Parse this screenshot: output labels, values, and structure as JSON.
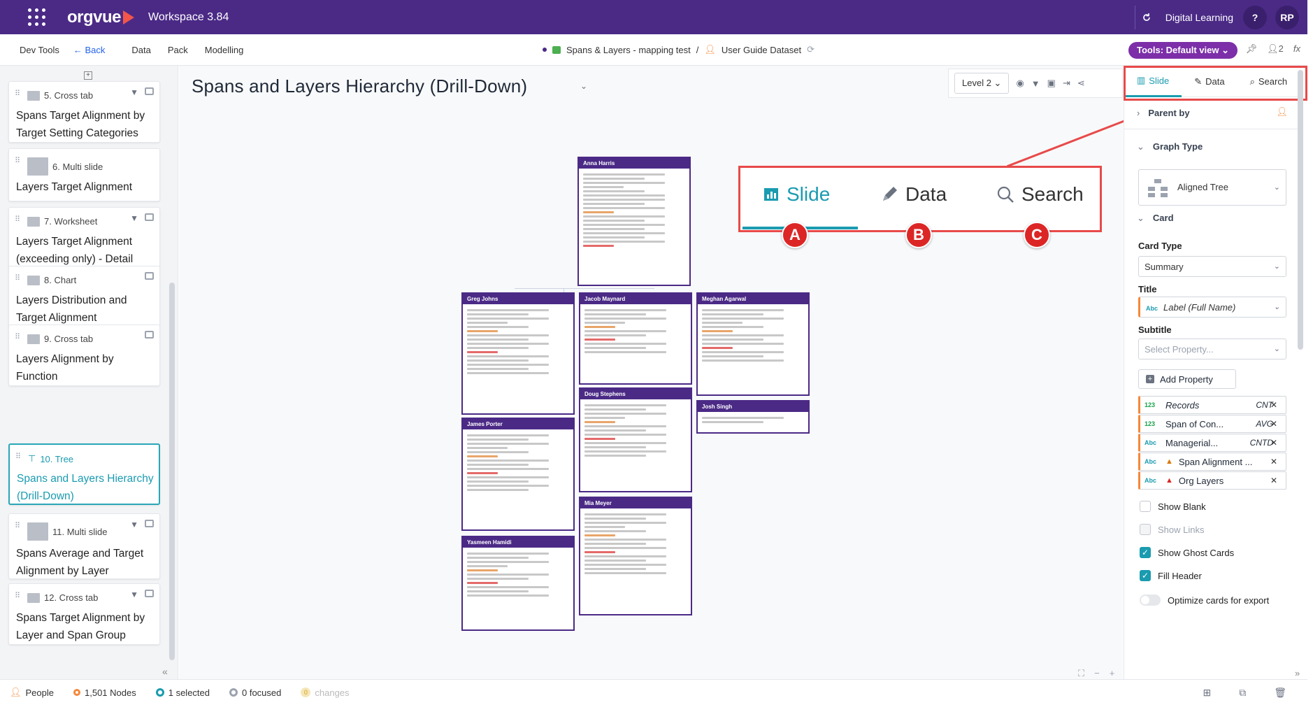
{
  "topbar": {
    "brand": "orgvue",
    "workspace": "Workspace 3.84",
    "user_label": "Digital Learning",
    "help": "?",
    "avatar": "RP"
  },
  "nav": {
    "items": [
      "Dev Tools",
      "Back",
      "Data",
      "Pack",
      "Modelling"
    ],
    "breadcrumb_doc": "Spans & Layers - mapping test",
    "breadcrumb_sep": "/",
    "breadcrumb_dataset": "User Guide Dataset",
    "tools_button": "Tools: Default view",
    "user_count": "2",
    "fx": "fx"
  },
  "left_panel": {
    "cards": [
      {
        "header": "5. Cross tab",
        "title": "Spans Target Alignment by Target Setting Categories"
      },
      {
        "header": "6. Multi slide",
        "title": "Layers Target Alignment"
      },
      {
        "header": "7. Worksheet",
        "title": "Layers Target Alignment (exceeding only) - Detail"
      },
      {
        "header": "8. Chart",
        "title": "Layers Distribution and Target Alignment"
      },
      {
        "header": "9. Cross tab",
        "title": "Layers Alignment by Function"
      },
      {
        "header": "10. Tree",
        "title": "Spans and Layers Hierarchy (Drill-Down)"
      },
      {
        "header": "11. Multi slide",
        "title": "Spans Average and Target Alignment by Layer"
      },
      {
        "header": "12. Cross tab",
        "title": "Spans Target Alignment by Layer and Span Group"
      }
    ]
  },
  "main": {
    "title": "Spans and Layers Hierarchy (Drill-Down)",
    "level": "Level 2",
    "tree_nodes": [
      "Anna Harris",
      "Greg Johns",
      "Jacob Maynard",
      "Meghan Agarwal",
      "Doug Stephens",
      "Josh Singh",
      "James Porter",
      "Mia Meyer",
      "Yasmeen Hamidi"
    ]
  },
  "zoom": {
    "tabs": [
      "Slide",
      "Data",
      "Search"
    ],
    "badges": [
      "A",
      "B",
      "C"
    ]
  },
  "right_panel": {
    "tabs": [
      "Slide",
      "Data",
      "Search"
    ],
    "parent_by": "Parent by",
    "graph_type_label": "Graph Type",
    "graph_type": "Aligned Tree",
    "card_label": "Card",
    "card_type_label": "Card Type",
    "card_type": "Summary",
    "title_label": "Title",
    "title_value": "Label (Full Name)",
    "subtitle_label": "Subtitle",
    "subtitle_placeholder": "Select Property...",
    "add_property": "Add Property",
    "properties": [
      {
        "type": "123",
        "name": "Records",
        "agg": "CNT"
      },
      {
        "type": "123",
        "name": "Span of Con...",
        "agg": "AVG"
      },
      {
        "type": "Abc",
        "name": "Managerial...",
        "agg": "CNTD"
      },
      {
        "type": "Abc",
        "name": "Span Alignment ...",
        "agg": ""
      },
      {
        "type": "Abc",
        "name": "Org Layers",
        "agg": ""
      }
    ],
    "checks": [
      {
        "label": "Show Blank",
        "checked": false
      },
      {
        "label": "Show Links",
        "checked": false
      },
      {
        "label": "Show Ghost Cards",
        "checked": true
      },
      {
        "label": "Fill Header",
        "checked": true
      }
    ],
    "optimize": "Optimize cards for export"
  },
  "status": {
    "people": "People",
    "nodes": "1,501 Nodes",
    "selected": "1 selected",
    "focused": "0 focused",
    "changes": "changes",
    "changes_count": "0"
  },
  "colors": {
    "brand": "#4b2a86",
    "accent": "#1a9bb0",
    "annotation": "#e84a4a",
    "tools": "#7c2fa8"
  }
}
